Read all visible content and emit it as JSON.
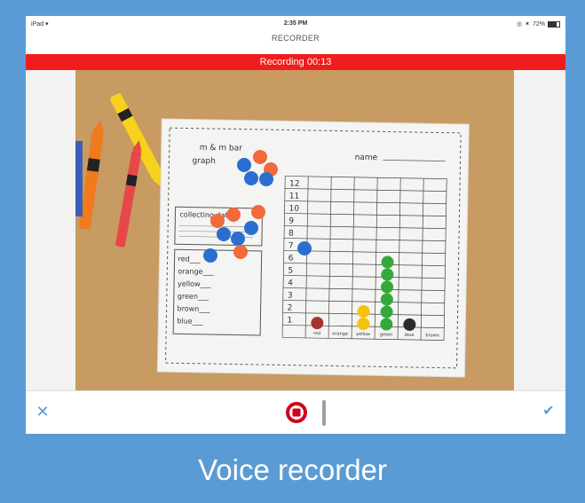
{
  "status_bar": {
    "device": "iPad",
    "time": "2:35 PM",
    "battery": "72%"
  },
  "header": {
    "title": "RECORDER"
  },
  "recording": {
    "label": "Recording 00:13"
  },
  "photo": {
    "worksheet": {
      "title_line1": "m & m bar",
      "title_line2": "graph",
      "name_label": "name",
      "collecting_heading": "collecting data",
      "y_ticks": [
        "12",
        "11",
        "10",
        "9",
        "8",
        "7",
        "6",
        "5",
        "4",
        "3",
        "2",
        "1"
      ],
      "colors": [
        "red",
        "orange",
        "yellow",
        "green",
        "brown",
        "blue"
      ],
      "x_labels": [
        "red",
        "orange",
        "yellow",
        "green",
        "blue",
        "brown"
      ],
      "counts": {
        "red": 1,
        "orange": 0,
        "yellow": 2,
        "green": 6,
        "blue": 1,
        "brown": 0
      }
    }
  },
  "toolbar": {
    "cancel_icon": "close-icon",
    "stop_icon": "stop-record-icon",
    "confirm_icon": "checkmark-icon"
  },
  "caption": "Voice recorder",
  "colors": {
    "background": "#5b9bd5",
    "recording_bar": "#f01d1d",
    "stop_button": "#d0021b",
    "accent": "#5b9bd5"
  }
}
